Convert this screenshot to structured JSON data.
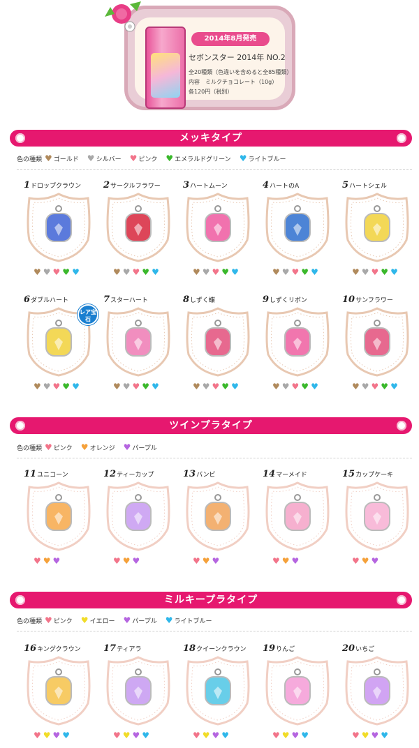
{
  "header": {
    "badge": "2014年8月発売",
    "title": "セボンスター 2014年 NO.2",
    "line1": "全20種類（色違いを含めると全85種類）",
    "line2": "内容　ミルクチョコレート（10g）",
    "line3": "各120円（税別）"
  },
  "colors": {
    "pink_banner": "#e6186f",
    "gold": "#b08a5c",
    "silver": "#a8a8a8",
    "pink": "#f2748a",
    "green": "#3ab82b",
    "lightblue": "#2fb7ea",
    "orange": "#f5a13a",
    "purple": "#b565e0",
    "yellow": "#f1dc28"
  },
  "sections": [
    {
      "title": "メッキタイプ",
      "legend_label": "色の種類",
      "legend": [
        "ゴールド",
        "シルバー",
        "ピンク",
        "エメラルドグリーン",
        "ライトブルー"
      ]
    },
    {
      "title": "ツインプラタイプ",
      "legend_label": "色の種類",
      "legend": [
        "ピンク",
        "オレンジ",
        "パープル"
      ]
    },
    {
      "title": "ミルキープラタイプ",
      "legend_label": "色の種類",
      "legend": [
        "ピンク",
        "イエロー",
        "パープル",
        "ライトブルー"
      ]
    }
  ],
  "items": [
    {
      "num": "1",
      "name": "ドロップクラウン"
    },
    {
      "num": "2",
      "name": "サークルフラワー"
    },
    {
      "num": "3",
      "name": "ハートムーン"
    },
    {
      "num": "4",
      "name": "ハートのA"
    },
    {
      "num": "5",
      "name": "ハートシェル"
    },
    {
      "num": "6",
      "name": "ダブルハート",
      "rare": "レア宝石"
    },
    {
      "num": "7",
      "name": "スターハート"
    },
    {
      "num": "8",
      "name": "しずく蝶"
    },
    {
      "num": "9",
      "name": "しずくリボン"
    },
    {
      "num": "10",
      "name": "サンフラワー"
    },
    {
      "num": "11",
      "name": "ユニコーン"
    },
    {
      "num": "12",
      "name": "ティーカップ"
    },
    {
      "num": "13",
      "name": "バンビ"
    },
    {
      "num": "14",
      "name": "マーメイド"
    },
    {
      "num": "15",
      "name": "カップケーキ"
    },
    {
      "num": "16",
      "name": "キングクラウン"
    },
    {
      "num": "17",
      "name": "ティアラ"
    },
    {
      "num": "18",
      "name": "クイーンクラウン"
    },
    {
      "num": "19",
      "name": "りんご"
    },
    {
      "num": "20",
      "name": "いちご"
    }
  ]
}
